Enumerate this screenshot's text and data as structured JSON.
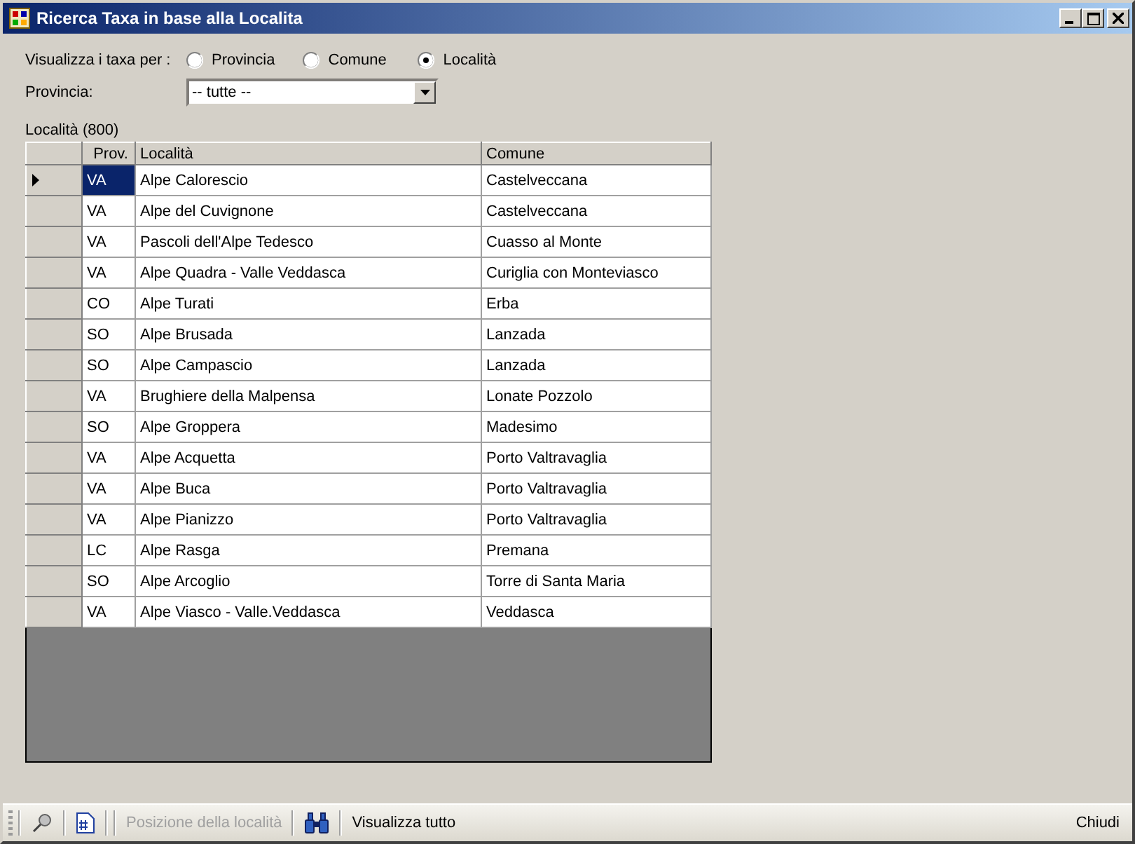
{
  "window": {
    "title": "Ricerca Taxa in base alla Localita"
  },
  "view_by": {
    "label": "Visualizza i taxa per :",
    "options": [
      {
        "label": "Provincia",
        "selected": false
      },
      {
        "label": "Comune",
        "selected": false
      },
      {
        "label": "Località",
        "selected": true
      }
    ]
  },
  "provincia": {
    "label": "Provincia:",
    "value": "-- tutte --"
  },
  "grid_label": "Località (800)",
  "table": {
    "columns": [
      "Prov.",
      "Località",
      "Comune"
    ],
    "rows": [
      {
        "cells": [
          "VA",
          "Alpe Calorescio",
          "Castelveccana"
        ],
        "selected": true
      },
      {
        "cells": [
          "VA",
          "Alpe del Cuvignone",
          "Castelveccana"
        ],
        "selected": false
      },
      {
        "cells": [
          "VA",
          "Pascoli dell'Alpe Tedesco",
          "Cuasso al Monte"
        ],
        "selected": false
      },
      {
        "cells": [
          "VA",
          "Alpe Quadra - Valle Veddasca",
          "Curiglia con Monteviasco"
        ],
        "selected": false
      },
      {
        "cells": [
          "CO",
          "Alpe Turati",
          "Erba"
        ],
        "selected": false
      },
      {
        "cells": [
          "SO",
          "Alpe Brusada",
          "Lanzada"
        ],
        "selected": false
      },
      {
        "cells": [
          "SO",
          "Alpe Campascio",
          "Lanzada"
        ],
        "selected": false
      },
      {
        "cells": [
          "VA",
          "Brughiere della Malpensa",
          "Lonate Pozzolo"
        ],
        "selected": false
      },
      {
        "cells": [
          "SO",
          "Alpe Groppera",
          "Madesimo"
        ],
        "selected": false
      },
      {
        "cells": [
          "VA",
          "Alpe Acquetta",
          "Porto Valtravaglia"
        ],
        "selected": false
      },
      {
        "cells": [
          "VA",
          "Alpe Buca",
          "Porto Valtravaglia"
        ],
        "selected": false
      },
      {
        "cells": [
          "VA",
          "Alpe Pianizzo",
          "Porto Valtravaglia"
        ],
        "selected": false
      },
      {
        "cells": [
          "LC",
          "Alpe Rasga",
          "Premana"
        ],
        "selected": false
      },
      {
        "cells": [
          "SO",
          "Alpe Arcoglio",
          "Torre di Santa Maria"
        ],
        "selected": false
      },
      {
        "cells": [
          "VA",
          "Alpe Viasco - Valle.Veddasca",
          "Veddasca"
        ],
        "selected": false
      }
    ]
  },
  "toolbar": {
    "items": [
      {
        "kind": "icon"
      },
      {
        "kind": "icon"
      },
      {
        "kind": "separator"
      },
      {
        "kind": "text",
        "label": "Posizione della località",
        "disabled": true
      },
      {
        "kind": "separator"
      },
      {
        "kind": "icon"
      },
      {
        "kind": "text",
        "label": "Visualizza tutto",
        "disabled": false
      }
    ],
    "right": "Chiudi"
  }
}
